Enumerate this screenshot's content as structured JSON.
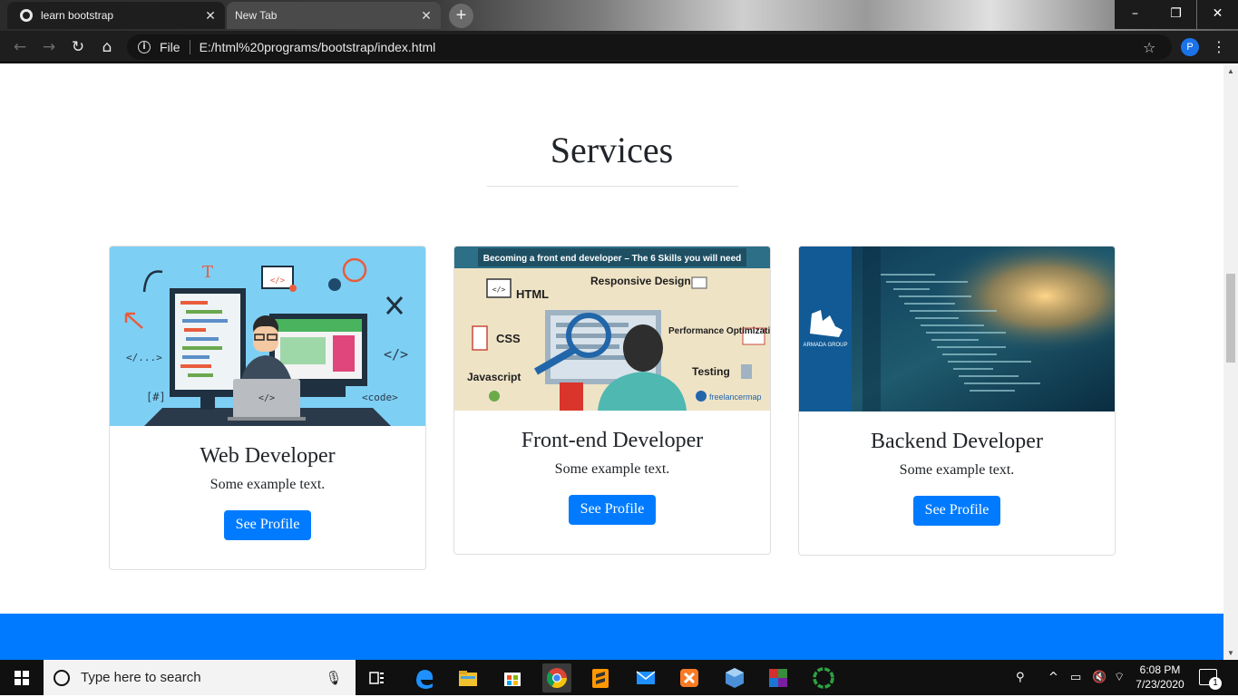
{
  "browser": {
    "tabs": [
      {
        "title": "learn bootstrap",
        "active": true
      },
      {
        "title": "New Tab",
        "active": false
      }
    ],
    "address": {
      "scheme_label": "File",
      "url": "E:/html%20programs/bootstrap/index.html"
    },
    "profile_initial": "P",
    "icons": {
      "back": "back-arrow-icon",
      "forward": "forward-arrow-icon",
      "reload": "reload-icon",
      "home": "home-icon",
      "info": "info-icon",
      "star": "star-icon",
      "menu": "kebab-menu-icon"
    }
  },
  "page": {
    "section_title": "Services",
    "cards": [
      {
        "title": "Web Developer",
        "text": "Some example text.",
        "button": "See Profile",
        "image": "web-developer-illustration"
      },
      {
        "title": "Front-end Developer",
        "text": "Some example text.",
        "button": "See Profile",
        "image": "front-end-skills-infographic",
        "image_text": {
          "banner": "Becoming a front end developer – The 6 Skills you will need",
          "skills": [
            "HTML",
            "Responsive Design",
            "CSS",
            "Performance Optimization",
            "Javascript",
            "Testing"
          ],
          "brand": "freelancermap"
        }
      },
      {
        "title": "Backend Developer",
        "text": "Some example text.",
        "button": "See Profile",
        "image": "code-screen-photo",
        "image_text": {
          "brand": "ARMADA GROUP"
        }
      }
    ],
    "colors": {
      "primary": "#007bff",
      "text": "#212529"
    }
  },
  "taskbar": {
    "search_placeholder": "Type here to search",
    "clock_time": "6:08 PM",
    "clock_date": "7/23/2020",
    "notification_count": "1",
    "apps": [
      "task-view",
      "edge",
      "file-explorer",
      "store",
      "chrome",
      "sublime-text",
      "mail",
      "xampp",
      "virtualbox",
      "winrar",
      "app-circle"
    ]
  }
}
